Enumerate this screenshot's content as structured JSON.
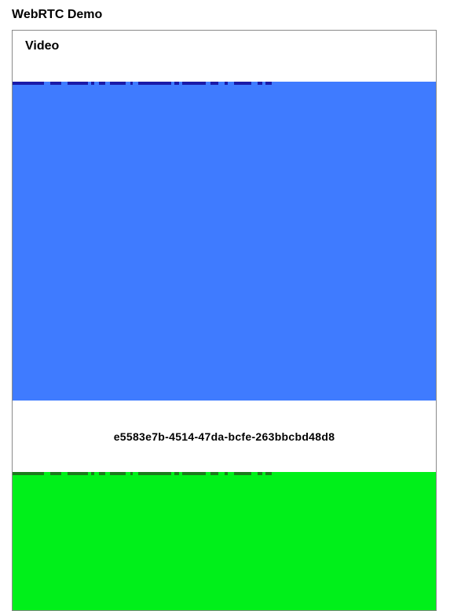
{
  "page": {
    "title": "WebRTC Demo"
  },
  "panel": {
    "heading": "Video",
    "session_id": "e5583e7b-4514-47da-bcfe-263bbcbd48d8"
  },
  "videos": {
    "remote": {
      "color": "#3f7bff",
      "stripe_color": "#1a1aa8"
    },
    "local": {
      "color": "#00f01a",
      "stripe_color": "#1c7a1c"
    }
  }
}
